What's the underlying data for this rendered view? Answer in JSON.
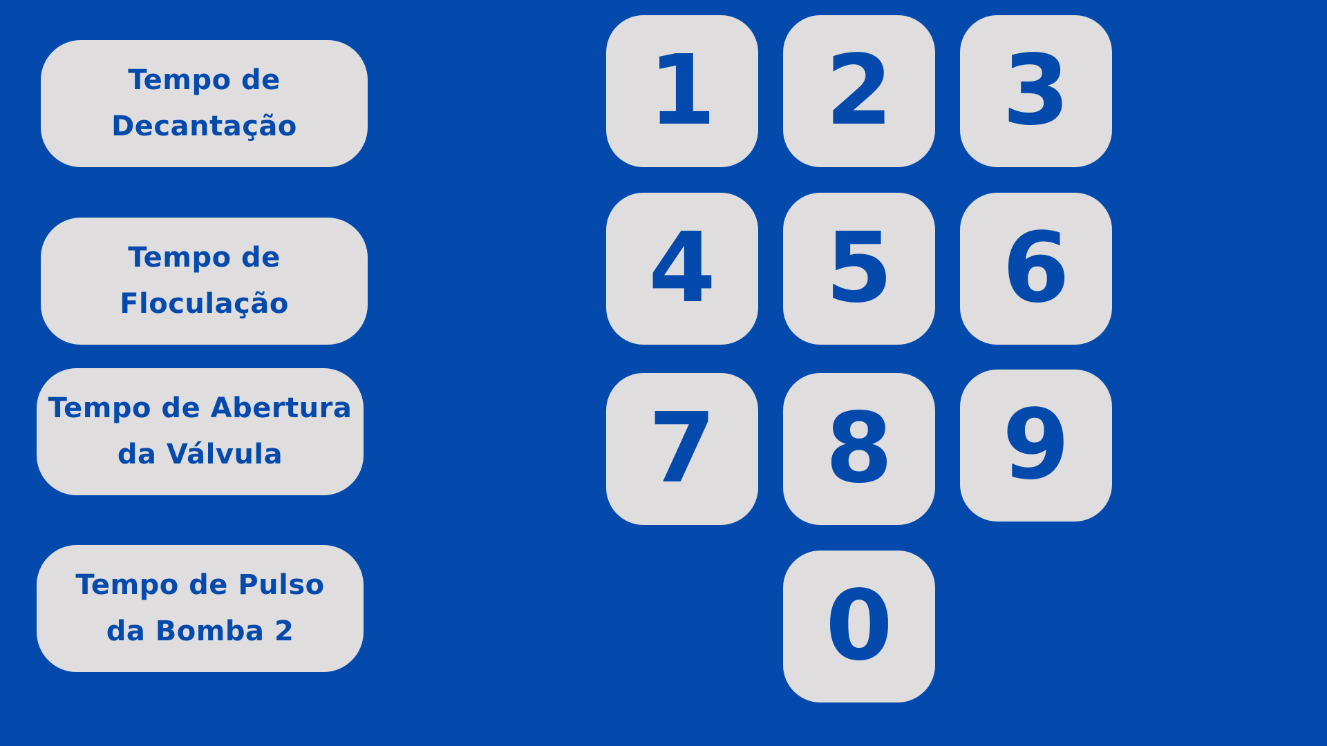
{
  "theme": {
    "background": "#034aac",
    "button_fill": "#dfdddd",
    "text_color": "#034aac"
  },
  "menu": [
    {
      "line1": "Tempo de",
      "line2": "Decantação"
    },
    {
      "line1": "Tempo de",
      "line2": "Floculação"
    },
    {
      "line1": "Tempo de Abertura",
      "line2": "da Válvula"
    },
    {
      "line1": "Tempo de Pulso",
      "line2": "da Bomba 2"
    }
  ],
  "keypad": {
    "keys": [
      "1",
      "2",
      "3",
      "4",
      "5",
      "6",
      "7",
      "8",
      "9",
      "0"
    ]
  }
}
